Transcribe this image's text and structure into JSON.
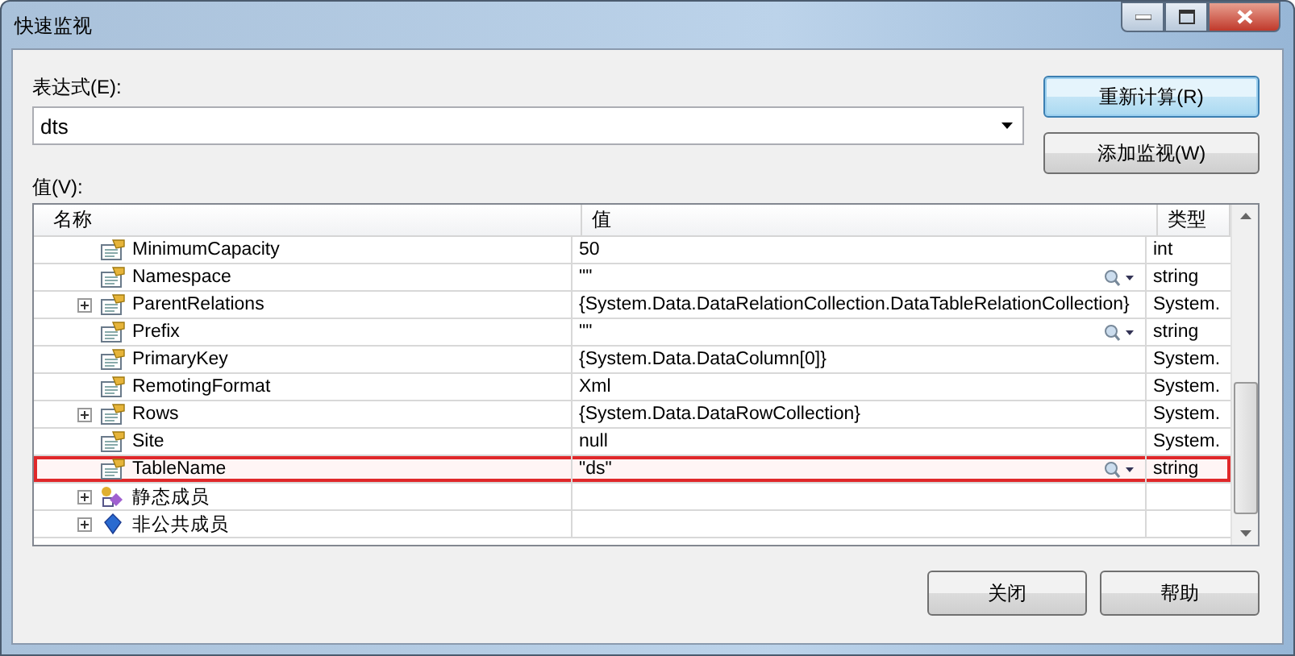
{
  "window": {
    "title": "快速监视"
  },
  "expression": {
    "label": "表达式(E):",
    "value": "dts"
  },
  "buttons_side": [
    "重新计算(R)",
    "添加监视(W)"
  ],
  "value_label": "值(V):",
  "table": {
    "columns": [
      "名称",
      "值",
      "类型"
    ],
    "rows": [
      {
        "name": "MinimumCapacity",
        "value": "50",
        "type": "int",
        "expandable": false,
        "kind": "property",
        "inspect": false,
        "highlighted": false
      },
      {
        "name": "Namespace",
        "value": "\"\"",
        "type": "string",
        "expandable": false,
        "kind": "property",
        "inspect": true,
        "highlighted": false
      },
      {
        "name": "ParentRelations",
        "value": "{System.Data.DataRelationCollection.DataTableRelationCollection}",
        "type": "System.",
        "expandable": true,
        "kind": "property",
        "inspect": false,
        "highlighted": false
      },
      {
        "name": "Prefix",
        "value": "\"\"",
        "type": "string",
        "expandable": false,
        "kind": "property",
        "inspect": true,
        "highlighted": false
      },
      {
        "name": "PrimaryKey",
        "value": "{System.Data.DataColumn[0]}",
        "type": "System.",
        "expandable": false,
        "kind": "property",
        "inspect": false,
        "highlighted": false
      },
      {
        "name": "RemotingFormat",
        "value": "Xml",
        "type": "System.",
        "expandable": false,
        "kind": "property",
        "inspect": false,
        "highlighted": false
      },
      {
        "name": "Rows",
        "value": "{System.Data.DataRowCollection}",
        "type": "System.",
        "expandable": true,
        "kind": "property",
        "inspect": false,
        "highlighted": false
      },
      {
        "name": "Site",
        "value": "null",
        "type": "System.",
        "expandable": false,
        "kind": "property",
        "inspect": false,
        "highlighted": false
      },
      {
        "name": "TableName",
        "value": "\"ds\"",
        "type": "string",
        "expandable": false,
        "kind": "property",
        "inspect": true,
        "highlighted": true
      },
      {
        "name": "静态成员",
        "expandable": true,
        "kind": "static",
        "inspect": false,
        "highlighted": false
      },
      {
        "name": "非公共成员",
        "expandable": true,
        "kind": "private",
        "inspect": false,
        "highlighted": false
      }
    ]
  },
  "buttons_bottom": [
    "关闭",
    "帮助"
  ]
}
